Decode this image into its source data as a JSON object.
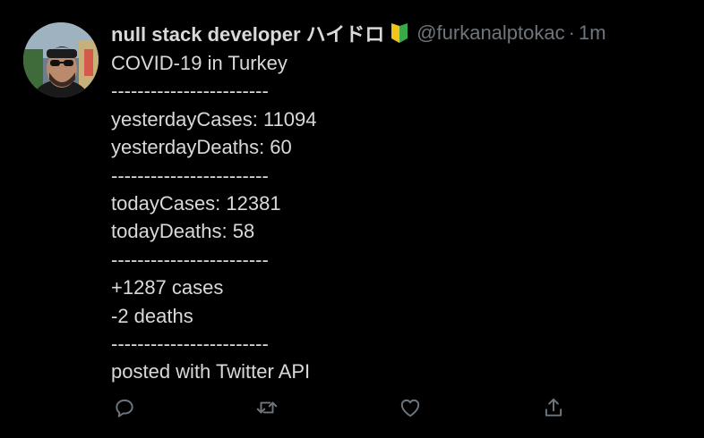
{
  "tweet": {
    "author_name": "null stack developer ハイドロ",
    "badge_icon": "beginner-leaf-badge-icon",
    "handle": "@furkanalptokac",
    "separator": "·",
    "time": "1m",
    "lines": [
      "COVID-19 in Turkey",
      "------------------------",
      "yesterdayCases: 11094",
      "yesterdayDeaths: 60",
      "------------------------",
      "todayCases: 12381",
      "todayDeaths: 58",
      "------------------------",
      "+1287 cases",
      "-2 deaths",
      "------------------------",
      "posted with Twitter API"
    ]
  },
  "actions": {
    "reply_icon": "reply-icon",
    "retweet_icon": "retweet-icon",
    "like_icon": "like-icon",
    "share_icon": "share-icon"
  },
  "colors": {
    "background": "#000000",
    "text": "#d9d9d9",
    "muted": "#6e767d"
  }
}
